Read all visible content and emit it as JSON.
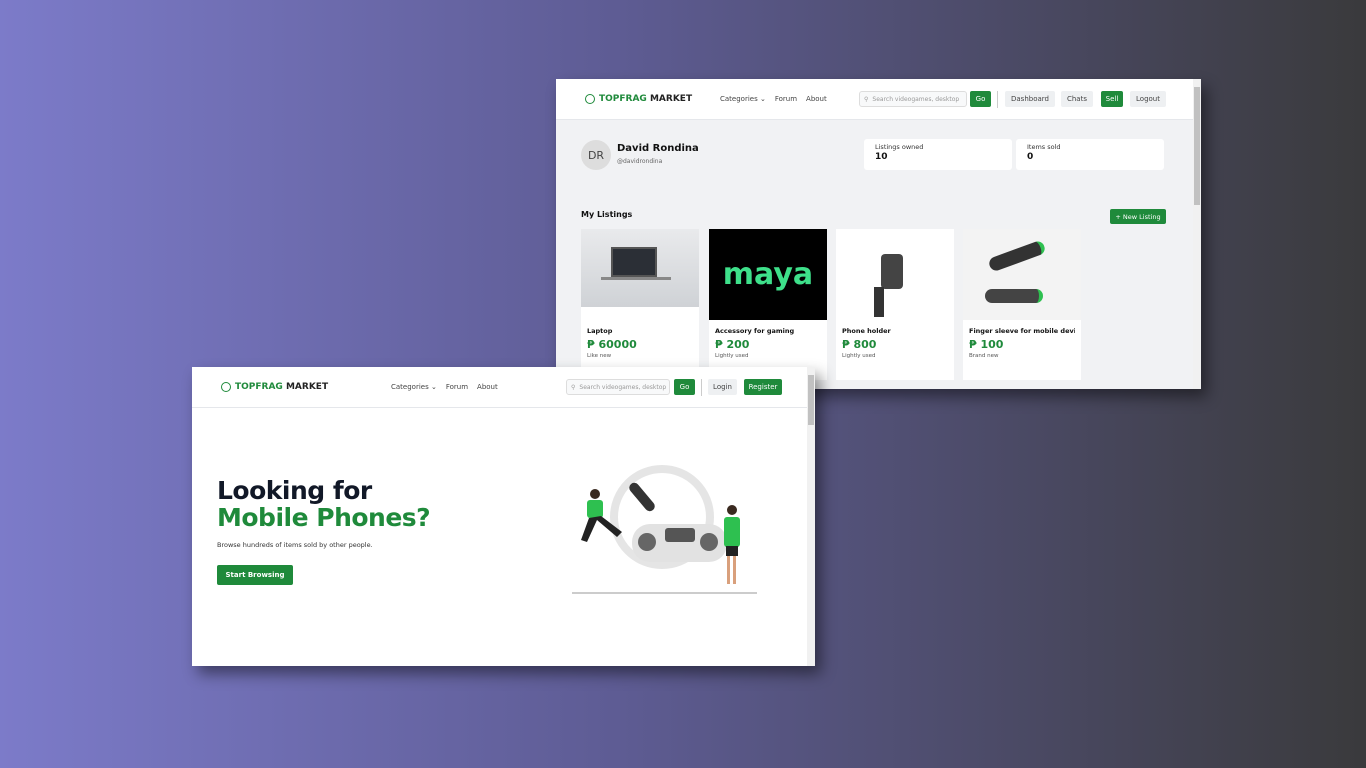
{
  "dashboard": {
    "logo": {
      "part1": "TOPFRAG",
      "part2": "MARKET"
    },
    "nav": {
      "categories": "Categories",
      "forum": "Forum",
      "about": "About"
    },
    "search_placeholder": "Search videogames, desktop",
    "go": "Go",
    "dashboard": "Dashboard",
    "chats": "Chats",
    "sell": "Sell",
    "logout": "Logout",
    "profile": {
      "initials": "DR",
      "name": "David Rondina",
      "handle": "@davidrondina"
    },
    "stats": [
      {
        "label": "Listings owned",
        "value": "10"
      },
      {
        "label": "Items sold",
        "value": "0"
      }
    ],
    "section_title": "My Listings",
    "new_listing": "+ New Listing",
    "listings": [
      {
        "title": "Laptop",
        "price": "₱ 60000",
        "condition": "Like new"
      },
      {
        "title": "Accessory for gaming",
        "price": "₱ 200",
        "condition": "Lightly used",
        "brand": "maya"
      },
      {
        "title": "Phone holder",
        "price": "₱ 800",
        "condition": "Lightly used"
      },
      {
        "title": "Finger sleeve for mobile devi...",
        "price": "₱ 100",
        "condition": "Brand new"
      }
    ]
  },
  "home": {
    "logo": {
      "part1": "TOPFRAG",
      "part2": "MARKET"
    },
    "nav": {
      "categories": "Categories",
      "forum": "Forum",
      "about": "About"
    },
    "search_placeholder": "Search videogames, desktop",
    "go": "Go",
    "login": "Login",
    "register": "Register",
    "hero": {
      "line1": "Looking for",
      "line2": "Mobile Phones?",
      "subtitle": "Browse hundreds of items sold by other people.",
      "cta": "Start Browsing"
    }
  },
  "colors": {
    "accent": "#1f8a3b"
  }
}
